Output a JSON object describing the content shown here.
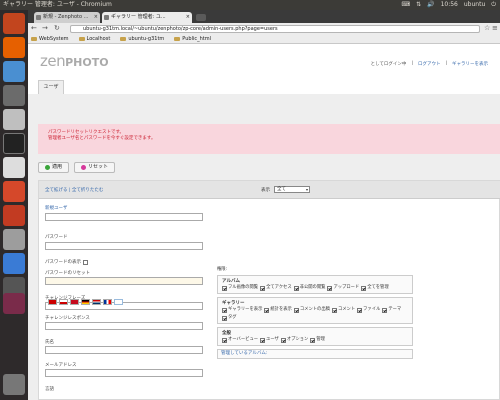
{
  "window": {
    "title": "ギャラリー 管理者: ユーザ - Chromium"
  },
  "system_tray": {
    "time": "10:56",
    "user": "ubuntu"
  },
  "tabs": [
    {
      "label": "新規 - Zenphoto ...",
      "active": false
    },
    {
      "label": "ギャラリー 管理者: ユ...",
      "active": true
    }
  ],
  "address": {
    "url": "ubuntu-g31tm.local/~ubuntu/zenphoto/zp-core/admin-users.php?page=users"
  },
  "bookmarks": [
    "WebSystem",
    "Localhost",
    "ubuntu-g31tm",
    "Public_html"
  ],
  "header": {
    "logo_main": "zen",
    "logo_bold": "PHOTO",
    "logged_in_as": "としてログイン中",
    "logout": "ログアウト",
    "view_gallery": "ギャラリーを表示",
    "tab_users": "ユーザ"
  },
  "alert": {
    "line1": "パスワードリセットリクエストです。",
    "line2": "管理者ユーザ名とパスワードを今すぐ設定できます。"
  },
  "buttons": {
    "apply": "適用",
    "reset": "リセット"
  },
  "filter": {
    "expand_all": "全て拡げる",
    "collapse_all": "全て折りたたむ",
    "show_label": "表示",
    "show_value": "全て"
  },
  "form": {
    "new_user": "新規ユーザ",
    "password": "パスワード",
    "show_password": "パスワードの表示",
    "password_reset": "パスワードのリセット",
    "challenge_phrase": "チャレンジフレーズ",
    "challenge_response": "チャレンジレスポンス",
    "name": "氏名",
    "email": "メールアドレス",
    "language": "言語"
  },
  "rights": {
    "title": "権限:",
    "album": {
      "title": "アルバム",
      "items": [
        "フル画像の閲覧",
        "全てアクセス",
        "非公開の閲覧",
        "アップロード",
        "全てを管理"
      ]
    },
    "gallery": {
      "title": "ギャラリー",
      "items": [
        "ギャラリーを表示",
        "統計を表示",
        "コメントの出稿",
        "コメント",
        "ファイル",
        "テーマ",
        "タグ"
      ]
    },
    "admin": {
      "title": "全般",
      "items": [
        "オーバービュー",
        "ユーザ",
        "オプション",
        "管理"
      ]
    },
    "managed_albums": "管理しているアルバム:"
  },
  "colors": {
    "alert_bg": "#f9d6dd",
    "alert_text": "#cc2233",
    "link": "#3366aa",
    "launcher_bg": "#2e2a2b",
    "apply_dot": "#3aa53a",
    "reset_dot": "#d6399b"
  },
  "launcher_icons": [
    "files-icon",
    "firefox-icon",
    "chromium-icon",
    "terminal-icon",
    "text-editor-icon",
    "document-icon",
    "ubuntu-software-icon",
    "settings-icon",
    "libreoffice-icon",
    "writer-icon",
    "workspace-icon",
    "trash-icon"
  ]
}
